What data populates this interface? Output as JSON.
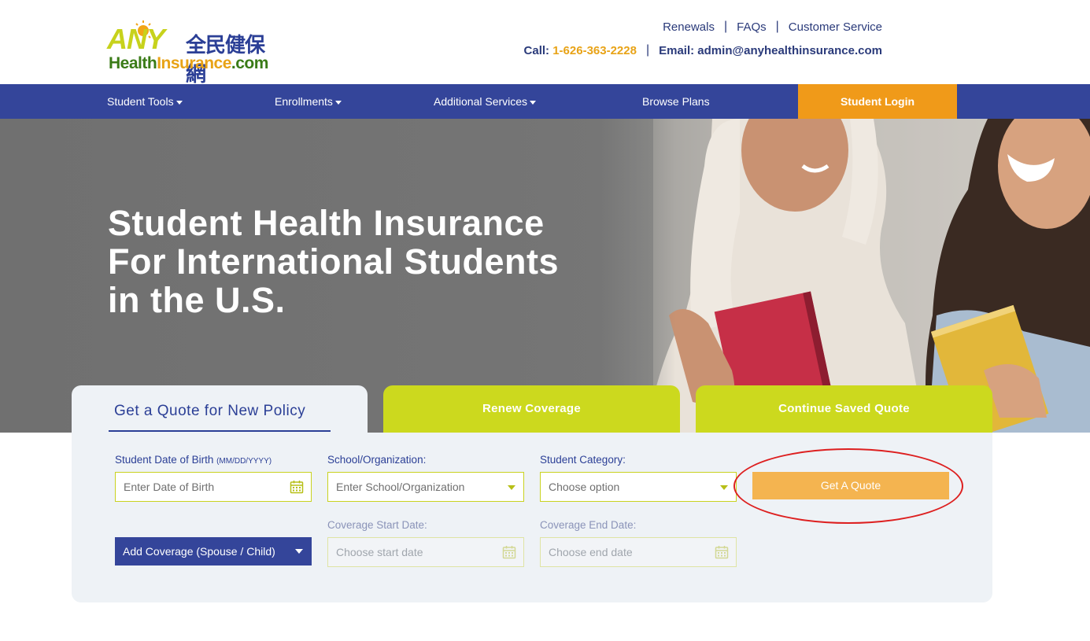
{
  "logo": {
    "any": "ANY",
    "cjk": "全民健保網",
    "health": "Health",
    "insurance": "Insurance",
    "com": ".com"
  },
  "top_links": {
    "renewals": "Renewals",
    "faqs": "FAQs",
    "customer_service": "Customer Service",
    "separator": "|"
  },
  "contact": {
    "call_label": "Call:",
    "phone": "1-626-363-2228",
    "email_label": "Email: admin@anyhealthinsurance.com"
  },
  "nav": {
    "student_tools": "Student Tools",
    "enrollments": "Enrollments",
    "additional_services": "Additional Services",
    "browse_plans": "Browse Plans",
    "student_login": "Student Login"
  },
  "hero": {
    "title_line1": "Student Health Insurance",
    "title_line2": "For International Students",
    "title_line3": "in the U.S."
  },
  "tabs": {
    "new_policy": "Get a Quote for New Policy",
    "renew": "Renew Coverage",
    "continue": "Continue Saved Quote"
  },
  "form": {
    "dob_label": "Student Date of Birth",
    "dob_format": "(MM/DD/YYYY)",
    "dob_placeholder": "Enter Date of Birth",
    "school_label": "School/Organization:",
    "school_placeholder": "Enter School/Organization",
    "category_label": "Student Category:",
    "category_value": "Choose option",
    "get_quote": "Get A Quote",
    "add_coverage": "Add Coverage (Spouse / Child)",
    "start_label": "Coverage Start Date:",
    "start_placeholder": "Choose start date",
    "end_label": "Coverage End Date:",
    "end_placeholder": "Choose end date"
  },
  "colors": {
    "primary_blue": "#34459a",
    "accent_orange": "#f09a19",
    "lime": "#ccd91e",
    "panel_bg": "#eef2f6",
    "annotation_red": "#dd1f1f"
  }
}
